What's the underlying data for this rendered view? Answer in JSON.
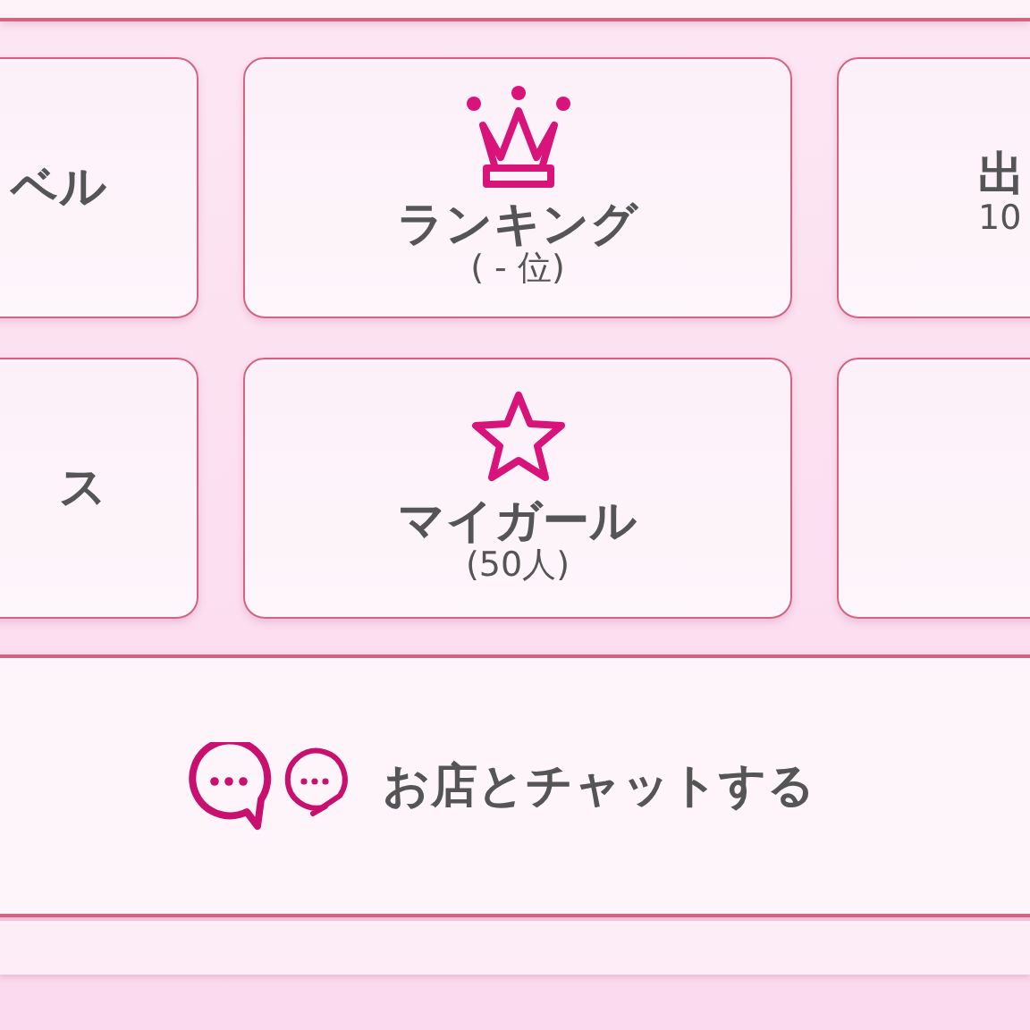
{
  "tiles": [
    {
      "kind": "cut_left",
      "label": "ベル"
    },
    {
      "kind": "crown",
      "label": "ランキング",
      "sub": "( - 位)"
    },
    {
      "kind": "cut_right",
      "label": "出",
      "sub": "10"
    },
    {
      "kind": "cut_left",
      "label": "ス"
    },
    {
      "kind": "star",
      "label": "マイガール",
      "sub": "(50人)"
    },
    {
      "kind": "cut_right"
    }
  ],
  "chat_button": {
    "label": "お店とチャットする"
  }
}
